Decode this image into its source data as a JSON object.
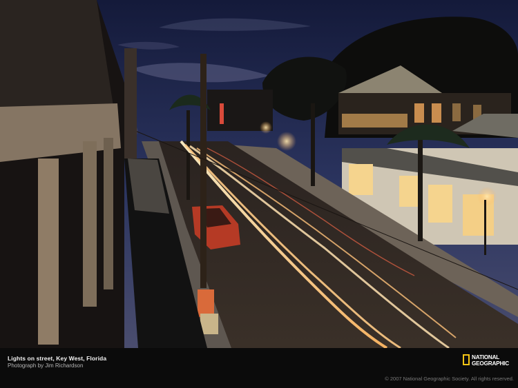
{
  "caption": {
    "title": "Lights on street, Key West, Florida",
    "credit": "Photograph by Jim Richardson"
  },
  "logo": {
    "line1": "NATIONAL",
    "line2": "GEOGRAPHIC",
    "frame_color": "#f6c515"
  },
  "copyright": "© 2007 National Geographic Society. All rights reserved.",
  "photo": {
    "sky_color": "#2c3560",
    "light_trail_color": "#ffd79a",
    "street_lamp_color": "#ffe9b0"
  }
}
